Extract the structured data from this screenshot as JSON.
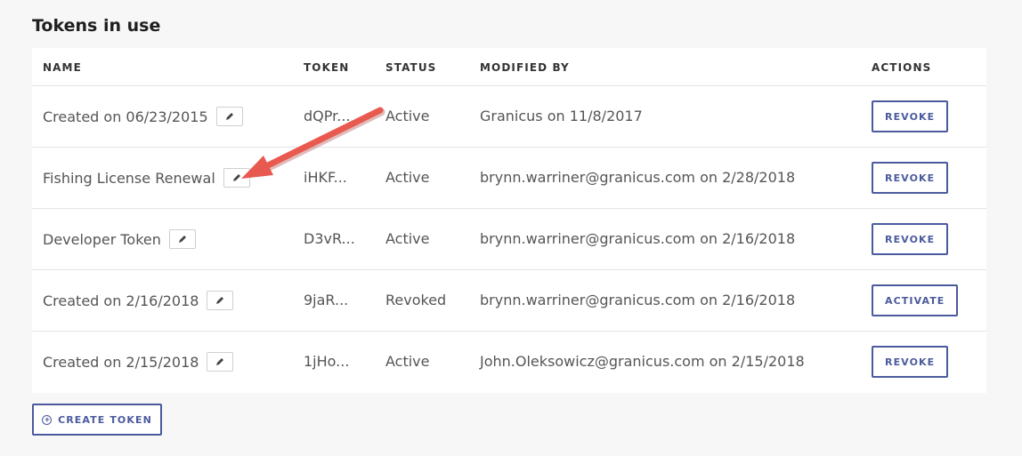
{
  "section": {
    "title": "Tokens in use"
  },
  "table": {
    "headers": {
      "name": "NAME",
      "token": "TOKEN",
      "status": "STATUS",
      "modified_by": "MODIFIED BY",
      "actions": "ACTIONS"
    },
    "rows": [
      {
        "name": "Created on 06/23/2015",
        "token": "dQPr...",
        "status": "Active",
        "modified_by": "Granicus on 11/8/2017",
        "action": "REVOKE"
      },
      {
        "name": "Fishing License Renewal",
        "token": "iHKF...",
        "status": "Active",
        "modified_by": "brynn.warriner@granicus.com on 2/28/2018",
        "action": "REVOKE"
      },
      {
        "name": "Developer Token",
        "token": "D3vR...",
        "status": "Active",
        "modified_by": "brynn.warriner@granicus.com on 2/16/2018",
        "action": "REVOKE"
      },
      {
        "name": "Created on 2/16/2018",
        "token": "9jaR...",
        "status": "Revoked",
        "modified_by": "brynn.warriner@granicus.com on 2/16/2018",
        "action": "ACTIVATE"
      },
      {
        "name": "Created on 2/15/2018",
        "token": "1jHo...",
        "status": "Active",
        "modified_by": "John.Oleksowicz@granicus.com on 2/15/2018",
        "action": "REVOKE"
      }
    ]
  },
  "create_button": {
    "label": "CREATE TOKEN",
    "icon": "plus-circle-icon"
  },
  "annotation": {
    "icon": "annotation-arrow",
    "color": "#e85a4f"
  },
  "colors": {
    "accent": "#4b5a9e",
    "background": "#f7f7f7",
    "card": "#ffffff"
  }
}
